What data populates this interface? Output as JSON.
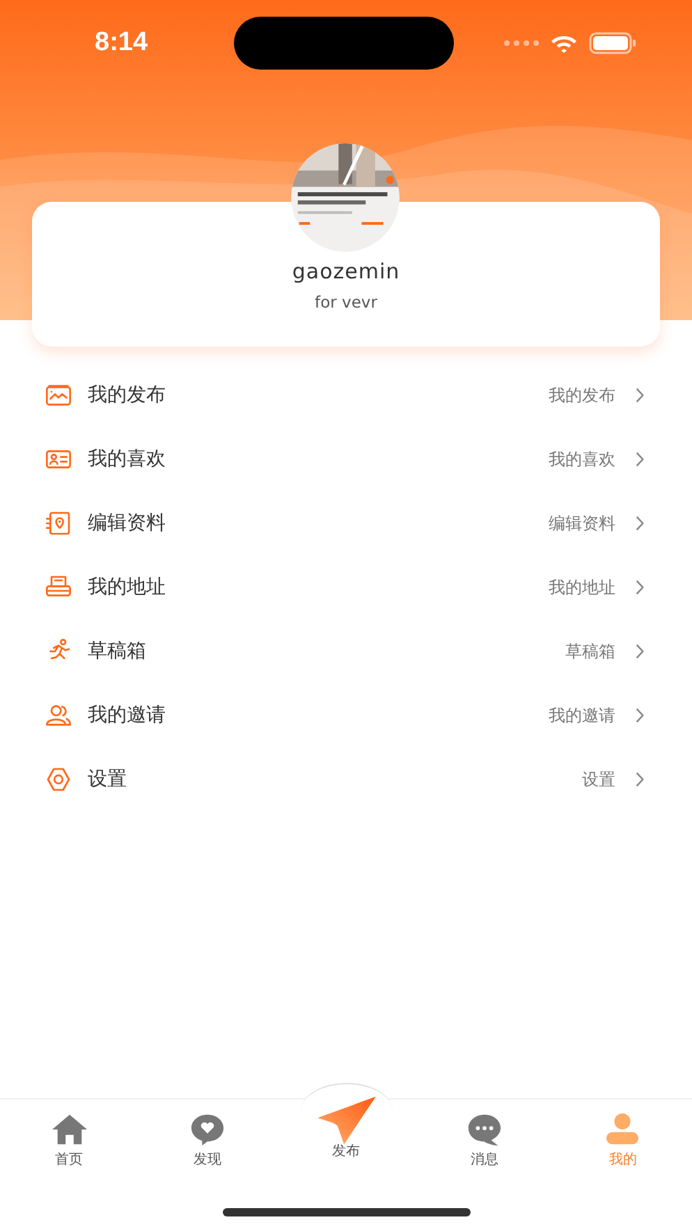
{
  "status_bar": {
    "time": "8:14"
  },
  "profile": {
    "username": "gaozemin",
    "bio": "for vevr"
  },
  "menu": [
    {
      "kind": "posts",
      "label": "我的发布",
      "value": "我的发布"
    },
    {
      "kind": "likes",
      "label": "我的喜欢",
      "value": "我的喜欢"
    },
    {
      "kind": "edit",
      "label": "编辑资料",
      "value": "编辑资料"
    },
    {
      "kind": "address",
      "label": "我的地址",
      "value": "我的地址"
    },
    {
      "kind": "drafts",
      "label": "草稿箱",
      "value": "草稿箱"
    },
    {
      "kind": "invite",
      "label": "我的邀请",
      "value": "我的邀请"
    },
    {
      "kind": "settings",
      "label": "设置",
      "value": "设置"
    }
  ],
  "tab_bar": [
    {
      "kind": "home",
      "label": "首页",
      "selected": false
    },
    {
      "kind": "discover",
      "label": "发现",
      "selected": false
    },
    {
      "kind": "publish",
      "label": "发布",
      "selected": false
    },
    {
      "kind": "messages",
      "label": "消息",
      "selected": false
    },
    {
      "kind": "profile",
      "label": "我的",
      "selected": true
    }
  ]
}
